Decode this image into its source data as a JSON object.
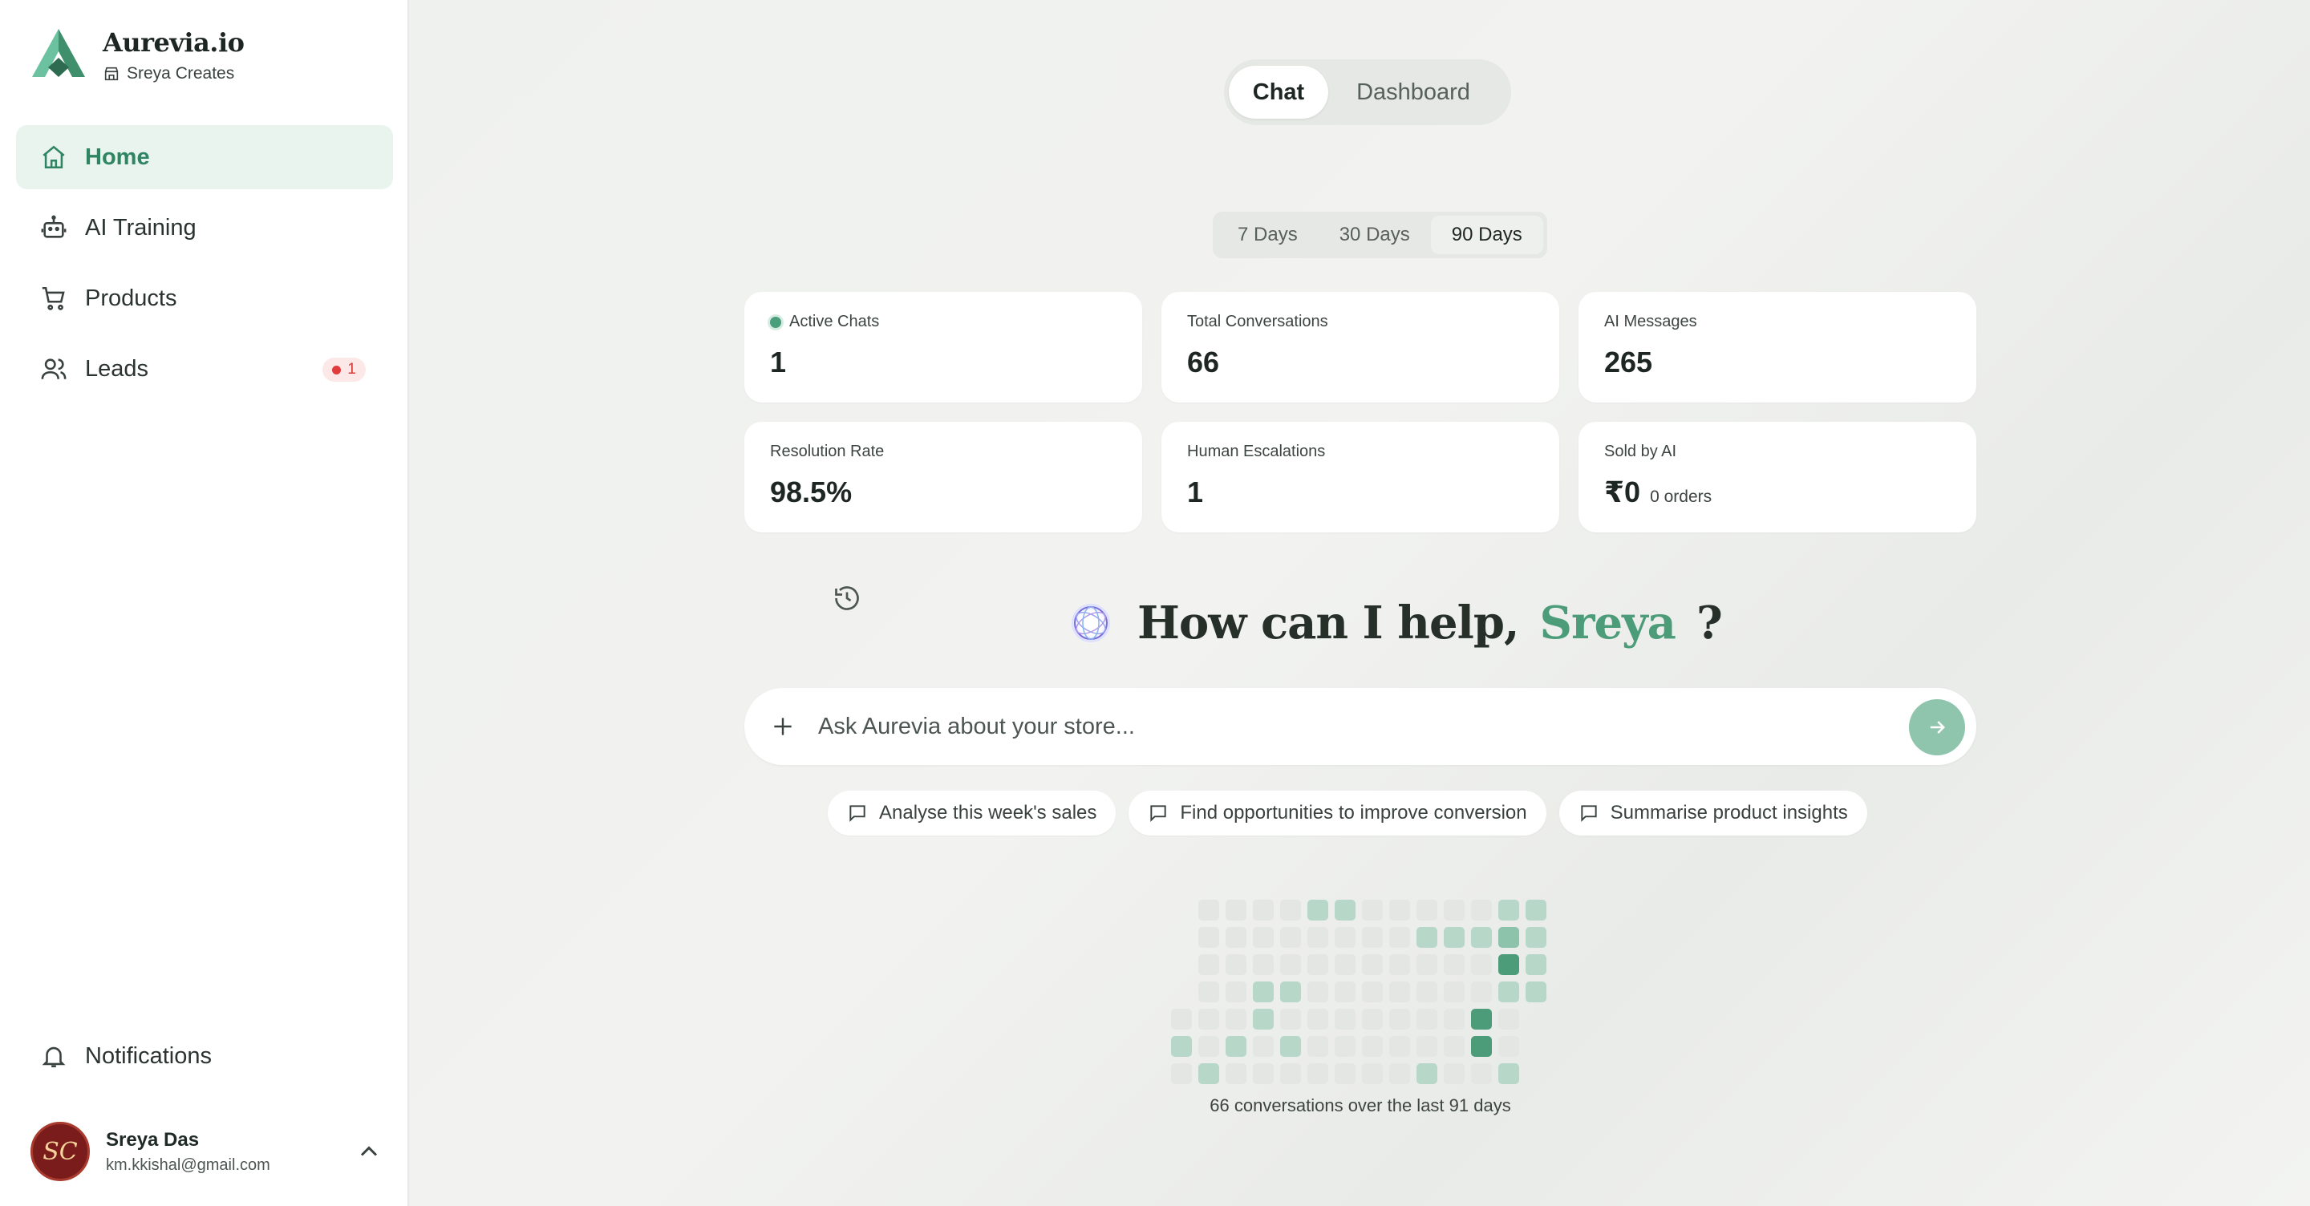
{
  "brand": {
    "name": "Aurevia.io",
    "store": "Sreya Creates",
    "accent": "#4c9c7a"
  },
  "nav": {
    "items": [
      {
        "label": "Home",
        "icon": "home-icon",
        "active": true
      },
      {
        "label": "AI Training",
        "icon": "robot-icon"
      },
      {
        "label": "Products",
        "icon": "cart-icon"
      },
      {
        "label": "Leads",
        "icon": "users-icon",
        "badge": "1"
      }
    ],
    "notifications": "Notifications"
  },
  "user": {
    "name": "Sreya Das",
    "email": "km.kkishal@gmail.com",
    "initials": "SC"
  },
  "view_toggle": {
    "chat": "Chat",
    "dashboard": "Dashboard",
    "selected": "Chat"
  },
  "range": {
    "options": [
      "7 Days",
      "30 Days",
      "90 Days"
    ],
    "selected": "90 Days"
  },
  "stats": [
    {
      "label": "Active Chats",
      "value": "1",
      "live": true
    },
    {
      "label": "Total Conversations",
      "value": "66"
    },
    {
      "label": "AI Messages",
      "value": "265"
    },
    {
      "label": "Resolution Rate",
      "value": "98.5%"
    },
    {
      "label": "Human Escalations",
      "value": "1"
    },
    {
      "label": "Sold by AI",
      "value": "₹0",
      "sub": "0 orders"
    }
  ],
  "greeting": {
    "prefix": "How can I help,",
    "name": "Sreya",
    "suffix": "?"
  },
  "ask": {
    "placeholder": "Ask Aurevia about your store..."
  },
  "suggestions": [
    "Analyse this week's sales",
    "Find opportunities to improve conversion",
    "Summarise product insights"
  ],
  "activity": {
    "caption": "66 conversations over the last 91 days",
    "levels_by_column": [
      [
        null,
        null,
        null,
        null,
        0,
        1,
        0
      ],
      [
        0,
        0,
        0,
        0,
        0,
        0,
        1
      ],
      [
        0,
        0,
        0,
        0,
        0,
        1,
        0
      ],
      [
        0,
        0,
        0,
        1,
        1,
        0,
        0
      ],
      [
        0,
        0,
        0,
        1,
        0,
        1,
        0
      ],
      [
        1,
        0,
        0,
        0,
        0,
        0,
        0
      ],
      [
        1,
        0,
        0,
        0,
        0,
        0,
        0
      ],
      [
        0,
        0,
        0,
        0,
        0,
        0,
        0
      ],
      [
        0,
        0,
        0,
        0,
        0,
        0,
        0
      ],
      [
        0,
        1,
        0,
        0,
        0,
        0,
        1
      ],
      [
        0,
        1,
        0,
        0,
        0,
        0,
        0
      ],
      [
        0,
        1,
        0,
        0,
        3,
        3,
        0
      ],
      [
        1,
        2,
        3,
        1,
        0,
        0,
        1
      ],
      [
        1,
        1,
        1,
        1,
        null,
        null,
        null
      ]
    ],
    "colors": [
      "#e3e6e3",
      "#b7d8c8",
      "#8cc3aa",
      "#4c9c7a"
    ]
  }
}
